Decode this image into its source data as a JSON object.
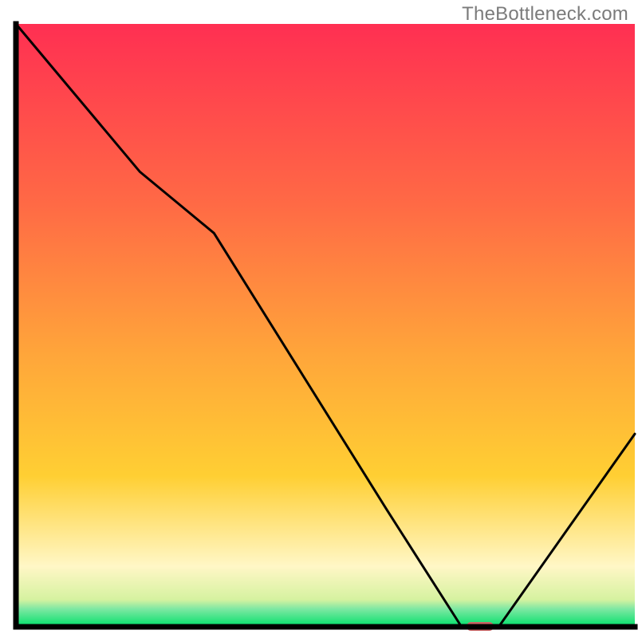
{
  "watermark": "TheBottleneck.com",
  "colors": {
    "gradient_top": "#ff2f52",
    "gradient_mid": "#ffcf33",
    "gradient_cream": "#fff7c6",
    "gradient_bottom": "#00e06a",
    "line": "#000000",
    "marker": "#cb6465",
    "axis": "#000000"
  },
  "chart_data": {
    "type": "line",
    "title": "",
    "xlabel": "",
    "ylabel": "",
    "xlim": [
      0,
      100
    ],
    "ylim": [
      0,
      100
    ],
    "grid": false,
    "series": [
      {
        "name": "bottleneck-pct-curve",
        "x": [
          0,
          20,
          32,
          60,
          72,
          78,
          100
        ],
        "y": [
          100,
          75.5,
          65.3,
          19.3,
          0,
          0,
          32
        ]
      }
    ],
    "annotations": [
      {
        "name": "sweet-spot-marker",
        "x": 75,
        "y": 0
      }
    ]
  }
}
